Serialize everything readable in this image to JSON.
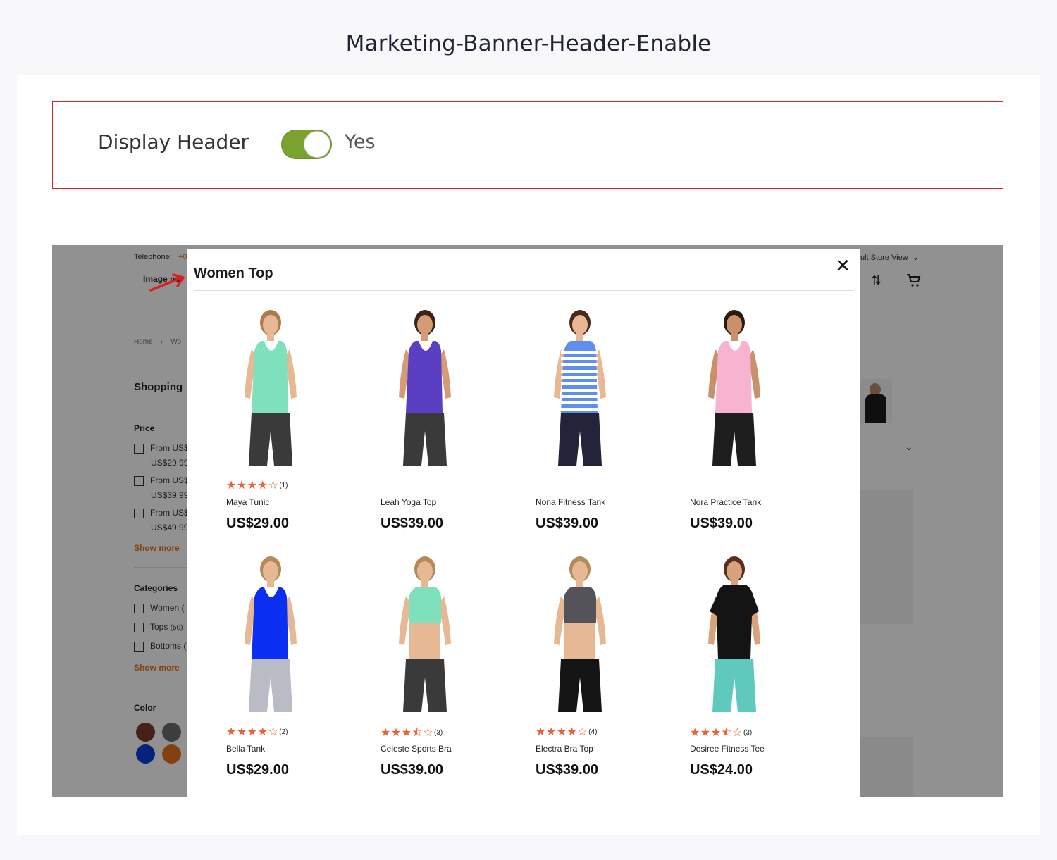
{
  "page": {
    "title": "Marketing-Banner-Header-Enable"
  },
  "config": {
    "label": "Display Header",
    "toggle_value": "Yes",
    "toggle_on": true,
    "accent_color": "#79a22e",
    "highlight_color": "#d9232d"
  },
  "store": {
    "telephone_label": "Telephone:",
    "telephone_value": "+0",
    "store_view": "ault Store View",
    "logo_text": "Image no",
    "breadcrumb_home": "Home",
    "breadcrumb_sep": "›",
    "breadcrumb_current": "Wo",
    "shopping_title": "Shopping",
    "price_title": "Price",
    "price_filters": [
      {
        "label": "From US$",
        "sub": "US$29.99"
      },
      {
        "label": "From US$",
        "sub": "US$39.99"
      },
      {
        "label": "From US$",
        "sub": "US$49.99"
      }
    ],
    "show_more": "Show more",
    "categories_title": "Categories",
    "category_filters": [
      {
        "label": "Women (",
        "count": ""
      },
      {
        "label": "Tops",
        "count": "(50)"
      },
      {
        "label": "Bottoms (",
        "count": ""
      }
    ],
    "color_title": "Color",
    "swatches": [
      "#7a3a2a",
      "#6b6b6b",
      "#0a3fd6",
      "#e4711c"
    ],
    "icons": [
      "compare-icon",
      "cart-icon",
      "chevron-down-icon"
    ]
  },
  "modal": {
    "title": "Women Top",
    "close_icon": "close-icon",
    "products": [
      {
        "name": "Maya Tunic",
        "price": "US$29.00",
        "stars": "★★★★☆",
        "count": "(1)",
        "top": "#7fe0bc",
        "bottom": "#3a3a3a",
        "skin": "#e7b894",
        "hair": "#b07a4a",
        "shape": "tank"
      },
      {
        "name": "Leah Yoga Top",
        "price": "US$39.00",
        "stars": "",
        "count": "",
        "top": "#5a3fc2",
        "bottom": "#3a3a3a",
        "skin": "#d49b74",
        "hair": "#3a2418",
        "shape": "tank"
      },
      {
        "name": "Nona Fitness Tank",
        "price": "US$39.00",
        "stars": "",
        "count": "",
        "top": "#5d8ef0",
        "bottom": "#23233a",
        "skin": "#e7b894",
        "hair": "#4a2a1a",
        "shape": "stripe"
      },
      {
        "name": "Nora Practice Tank",
        "price": "US$39.00",
        "stars": "",
        "count": "",
        "top": "#f6b4d0",
        "bottom": "#1e1e1e",
        "skin": "#c9906a",
        "hair": "#2a1a12",
        "shape": "tank"
      },
      {
        "name": "Bella Tank",
        "price": "US$29.00",
        "stars": "★★★★☆",
        "count": "(2)",
        "top": "#0a2ff0",
        "bottom": "#b9bcc4",
        "skin": "#e7b894",
        "hair": "#b38a5a",
        "shape": "tank"
      },
      {
        "name": "Celeste Sports Bra",
        "price": "US$39.00",
        "stars": "★★★⯪☆",
        "count": "(3)",
        "top": "#7fe0bc",
        "bottom": "#3a3a3a",
        "skin": "#e7b894",
        "hair": "#b38a5a",
        "shape": "bra"
      },
      {
        "name": "Electra Bra Top",
        "price": "US$39.00",
        "stars": "★★★★☆",
        "count": "(4)",
        "top": "#55535a",
        "bottom": "#141414",
        "skin": "#e7b894",
        "hair": "#b38a5a",
        "shape": "bra"
      },
      {
        "name": "Desiree Fitness Tee",
        "price": "US$24.00",
        "stars": "★★★⯪☆",
        "count": "(3)",
        "top": "#141414",
        "bottom": "#5fc9bd",
        "skin": "#d8a27c",
        "hair": "#5a2e1c",
        "shape": "tee"
      }
    ]
  }
}
